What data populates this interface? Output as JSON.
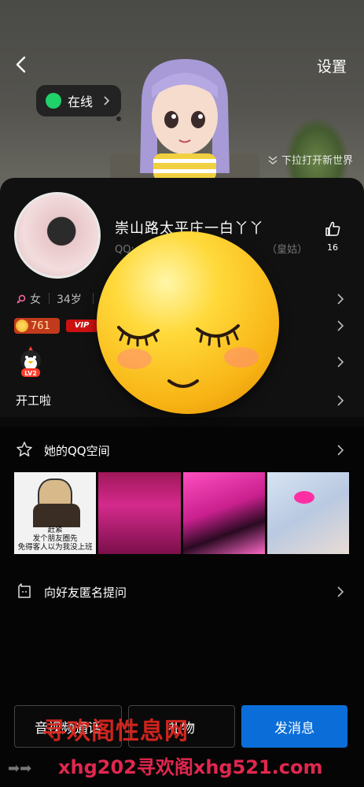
{
  "header": {
    "back_icon": "chevron-left-icon",
    "settings_label": "设置",
    "online_label": "在线",
    "pull_hint": "下拉打开新世界"
  },
  "profile": {
    "nickname": "崇山路太平庄一白丫丫",
    "qq_line": "QQ:",
    "qq_suffix": "（皇姑）",
    "like_count": "16",
    "gender": "女",
    "age": "34岁",
    "coin_value": "761",
    "vip_label": "VIP",
    "level_label": "LV2",
    "signature": "开工啦"
  },
  "space": {
    "title": "她的QQ空间",
    "meme_text_line1": "赶紧",
    "meme_text_line2": "发个朋友圈先",
    "meme_text_line3": "免得客人以为我没上班"
  },
  "ask": {
    "title": "向好友匿名提问"
  },
  "actions": {
    "av_call_label": "音视频通话",
    "gift_label": "礼物",
    "message_label": "发消息"
  },
  "watermark": {
    "line1": "寻欢阁性息网",
    "line2": "xhg202寻欢阁xhg521.com"
  },
  "colors": {
    "online_green": "#1fd26a",
    "primary_blue": "#0b6ed8",
    "watermark_red": "#e0271f"
  }
}
